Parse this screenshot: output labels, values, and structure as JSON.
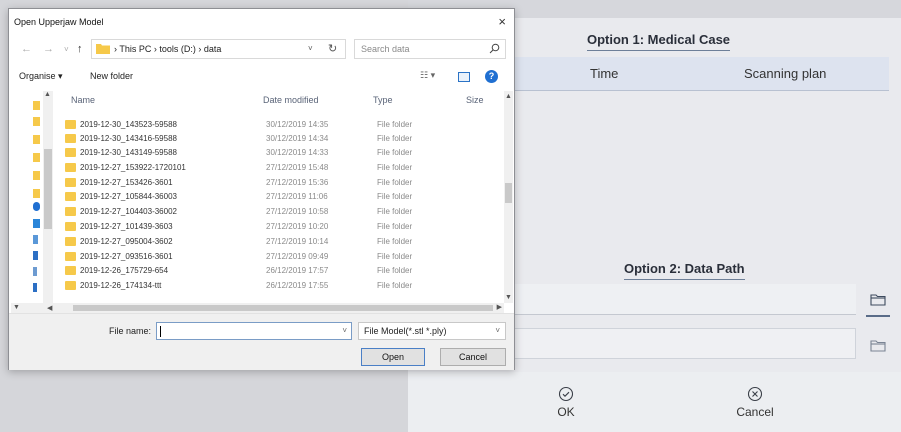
{
  "app": {
    "option1_title": "Option 1:  Medical Case",
    "columns": [
      "Time",
      "Scanning plan"
    ],
    "option2_title": "Option 2:  Data Path",
    "ok_label": "OK",
    "cancel_label": "Cancel"
  },
  "dialog": {
    "title": "Open Upperjaw Model",
    "close_glyph": "×",
    "address": {
      "segments": "› This PC › tools (D:) › data"
    },
    "search_placeholder": "Search data",
    "toolbar": {
      "organise_label": "Organise ▾",
      "new_folder_label": "New folder"
    },
    "columns": {
      "name": "Name",
      "date": "Date modified",
      "type": "Type",
      "size": "Size"
    },
    "files": [
      {
        "name": "2019-12-30_143523-59588",
        "date": "30/12/2019 14:35",
        "type": "File folder"
      },
      {
        "name": "2019-12-30_143416-59588",
        "date": "30/12/2019 14:34",
        "type": "File folder"
      },
      {
        "name": "2019-12-30_143149-59588",
        "date": "30/12/2019 14:33",
        "type": "File folder"
      },
      {
        "name": "2019-12-27_153922-1720101",
        "date": "27/12/2019 15:48",
        "type": "File folder"
      },
      {
        "name": "2019-12-27_153426-3601",
        "date": "27/12/2019 15:36",
        "type": "File folder"
      },
      {
        "name": "2019-12-27_105844-36003",
        "date": "27/12/2019 11:06",
        "type": "File folder"
      },
      {
        "name": "2019-12-27_104403-36002",
        "date": "27/12/2019 10:58",
        "type": "File folder"
      },
      {
        "name": "2019-12-27_101439-3603",
        "date": "27/12/2019 10:20",
        "type": "File folder"
      },
      {
        "name": "2019-12-27_095004-3602",
        "date": "27/12/2019 10:14",
        "type": "File folder"
      },
      {
        "name": "2019-12-27_093516-3601",
        "date": "27/12/2019 09:49",
        "type": "File folder"
      },
      {
        "name": "2019-12-26_175729-654",
        "date": "26/12/2019 17:57",
        "type": "File folder"
      },
      {
        "name": "2019-12-26_174134-ttt",
        "date": "26/12/2019 17:55",
        "type": "File folder"
      }
    ],
    "filename_label": "File name:",
    "filename_value": "",
    "filetype_value": "File Model(*.stl *.ply)",
    "open_label": "Open",
    "cancel_label": "Cancel"
  },
  "colors": {
    "folder": "#f6c94a",
    "accent": "#1f6fd1",
    "table_header": "#dde3ef"
  }
}
